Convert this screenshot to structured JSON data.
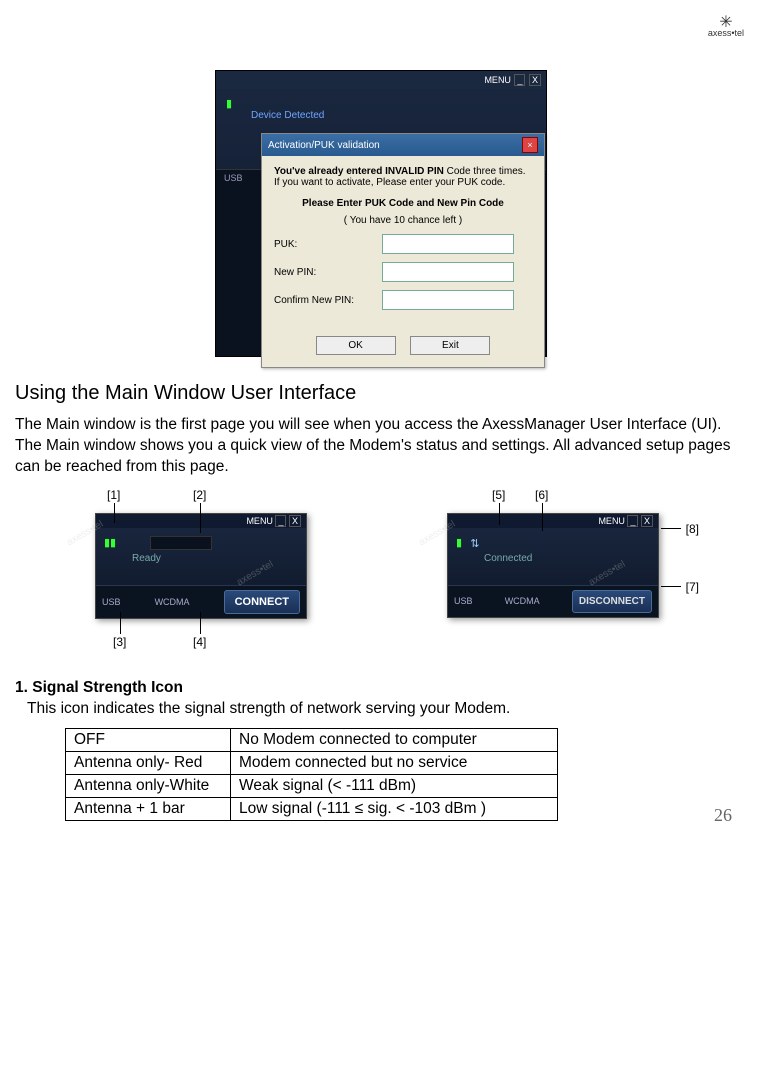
{
  "brand": "axess•tel",
  "top_screenshot": {
    "menu_label": "MENU",
    "device_status": "Device Detected",
    "footer_usb": "USB",
    "dialog": {
      "title": "Activation/PUK validation",
      "warning_bold": "You've already entered INVALID PIN",
      "warning_rest": " Code three times. If you want to activate, Please enter your PUK code.",
      "instruction": "Please Enter PUK Code and New Pin Code",
      "chances": "( You have 10 chance left )",
      "fields": {
        "puk": "PUK:",
        "new_pin": "New PIN:",
        "confirm_pin": "Confirm New PIN:"
      },
      "ok": "OK",
      "exit": "Exit"
    }
  },
  "section_heading": "Using the Main Window User Interface",
  "section_body": "The Main window is the first page you will see when you access the AxessManager User Interface (UI). The Main window shows you a quick view of the Modem's status and settings. All advanced setup pages can be reached from this page.",
  "main_screens": {
    "left": {
      "status": "Ready",
      "usb": "USB",
      "mode": "WCDMA",
      "button": "CONNECT",
      "menu": "MENU",
      "callouts": {
        "c1": "[1]",
        "c2": "[2]",
        "c3": "[3]",
        "c4": "[4]"
      }
    },
    "right": {
      "status": "Connected",
      "usb": "USB",
      "mode": "WCDMA",
      "button": "DISCONNECT",
      "menu": "MENU",
      "callouts": {
        "c5": "[5]",
        "c6": "[6]",
        "c7": "[7]",
        "c8": "[8]"
      }
    }
  },
  "subsection": {
    "title": "1. Signal Strength Icon",
    "body": "This icon indicates the signal strength of network serving your Modem."
  },
  "signal_table": [
    {
      "state": "OFF",
      "desc": "No Modem connected to computer"
    },
    {
      "state": "Antenna only- Red",
      "desc": "Modem connected but no service"
    },
    {
      "state": "Antenna only-White",
      "desc": "Weak signal (< -111 dBm)"
    },
    {
      "state": "Antenna + 1 bar",
      "desc": "Low signal (-111 ≤ sig. < -103 dBm )"
    }
  ],
  "page_number": "26"
}
